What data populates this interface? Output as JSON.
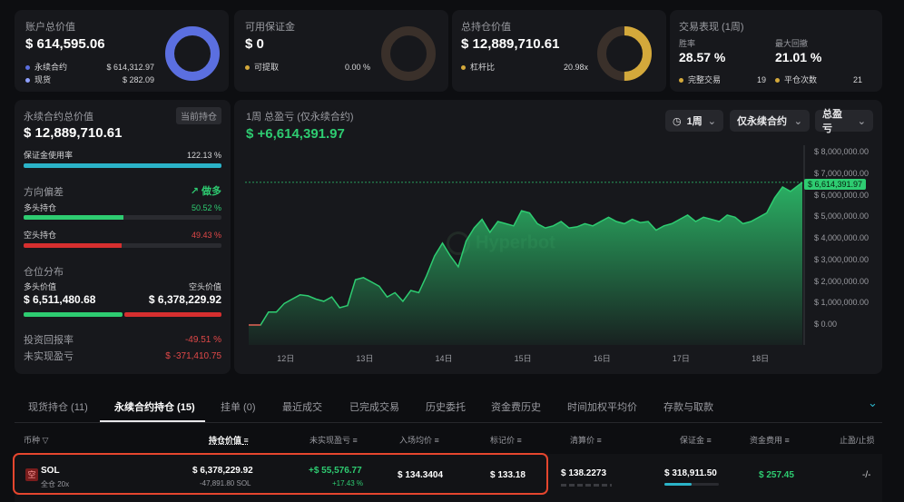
{
  "cards": {
    "account": {
      "title": "账户总价值",
      "value": "$ 614,595.06",
      "rows": [
        {
          "label": "永续合约",
          "value": "$ 614,312.97",
          "color": "#5b6fe0"
        },
        {
          "label": "现货",
          "value": "$ 282.09",
          "color": "#8fa0ff"
        }
      ],
      "ring_fill": 1.0,
      "ring_color": "#5b6fe0"
    },
    "margin": {
      "title": "可用保证金",
      "value": "$ 0",
      "rows": [
        {
          "label": "可提取",
          "value": "0.00 %",
          "color": "#d4a93b"
        }
      ],
      "ring_fill": 0.0,
      "ring_color": "#3a302a"
    },
    "position": {
      "title": "总持仓价值",
      "value": "$ 12,889,710.61",
      "rows": [
        {
          "label": "杠杆比",
          "value": "20.98x",
          "color": "#d4a93b"
        }
      ],
      "ring_fill": 0.5,
      "ring_color": "#d4a93b"
    },
    "performance": {
      "title": "交易表现 (1周)",
      "win_label": "胜率",
      "win_value": "28.57 %",
      "dd_label": "最大回撤",
      "dd_value": "21.01 %",
      "done_label": "完整交易",
      "done_value": "19",
      "close_label": "平仓次数",
      "close_value": "21",
      "dot_color": "#d4a93b"
    }
  },
  "perp": {
    "title": "永续合约总价值",
    "tag": "当前持仓",
    "value": "$ 12,889,710.61",
    "margin_label": "保证金使用率",
    "margin_value": "122.13 %",
    "margin_fill": 1.0,
    "bias_title": "方向偏差",
    "bias_value": "做多",
    "long_label": "多头持仓",
    "long_value": "50.52 %",
    "long_fill": 0.5052,
    "short_label": "空头持仓",
    "short_value": "49.43 %",
    "short_fill": 0.4943,
    "dist_title": "仓位分布",
    "long_val_label": "多头价值",
    "long_val": "$ 6,511,480.68",
    "short_val_label": "空头价值",
    "short_val": "$ 6,378,229.92",
    "roi_label": "投资回报率",
    "roi_value": "-49.51 %",
    "upnl_label": "未实现盈亏",
    "upnl_value": "$ -371,410.75"
  },
  "chart_panel": {
    "title": "1周 总盈亏 (仅永续合约)",
    "value": "$ +6,614,391.97",
    "dd_period": "1周",
    "dd_scope": "仅永续合约",
    "dd_metric": "总盈亏",
    "watermark": "Hyperbot"
  },
  "chart_data": {
    "type": "area",
    "ylim": [
      0,
      8000000
    ],
    "xlim": [
      11.55,
      18.55
    ],
    "yticks": [
      "$ 0.00",
      "$ 1,000,000.00",
      "$ 2,000,000.00",
      "$ 3,000,000.00",
      "$ 4,000,000.00",
      "$ 5,000,000.00",
      "$ 6,000,000.00",
      "$ 7,000,000.00",
      "$ 8,000,000.00"
    ],
    "xticks": [
      {
        "label": "12日",
        "x": 12
      },
      {
        "label": "13日",
        "x": 13
      },
      {
        "label": "14日",
        "x": 14
      },
      {
        "label": "15日",
        "x": 15
      },
      {
        "label": "16日",
        "x": 16
      },
      {
        "label": "17日",
        "x": 17
      },
      {
        "label": "18日",
        "x": 18
      }
    ],
    "last_label": "$ 6,614,391.97",
    "last_value": 6614391.97,
    "color": "#2ecc71",
    "x": [
      11.55,
      11.7,
      11.8,
      11.9,
      12.0,
      12.1,
      12.2,
      12.3,
      12.4,
      12.5,
      12.6,
      12.7,
      12.8,
      12.9,
      13.0,
      13.1,
      13.2,
      13.3,
      13.4,
      13.5,
      13.6,
      13.7,
      13.8,
      13.9,
      14.0,
      14.1,
      14.2,
      14.3,
      14.4,
      14.5,
      14.6,
      14.7,
      14.8,
      14.9,
      15.0,
      15.1,
      15.2,
      15.3,
      15.4,
      15.5,
      15.6,
      15.7,
      15.8,
      15.9,
      16.0,
      16.1,
      16.2,
      16.3,
      16.4,
      16.5,
      16.6,
      16.7,
      16.8,
      16.9,
      17.0,
      17.1,
      17.2,
      17.3,
      17.4,
      17.5,
      17.6,
      17.7,
      17.8,
      17.9,
      18.0,
      18.1,
      18.2,
      18.3,
      18.4,
      18.55
    ],
    "y": [
      0,
      0,
      600000,
      600000,
      1000000,
      1200000,
      1400000,
      1350000,
      1200000,
      1100000,
      1300000,
      800000,
      900000,
      2100000,
      2200000,
      2000000,
      1800000,
      1300000,
      1500000,
      1100000,
      1600000,
      1500000,
      2300000,
      3200000,
      3800000,
      3200000,
      2700000,
      3900000,
      4500000,
      4900000,
      4300000,
      4800000,
      4700000,
      4600000,
      5300000,
      5200000,
      4700000,
      4500000,
      4600000,
      4800000,
      4500000,
      4550000,
      4700000,
      4600000,
      4800000,
      5000000,
      4800000,
      4700000,
      4900000,
      4750000,
      4800000,
      4400000,
      4600000,
      4700000,
      4900000,
      5100000,
      4800000,
      5000000,
      4900000,
      4800000,
      5100000,
      5000000,
      4700000,
      4800000,
      5000000,
      5200000,
      5900000,
      6400000,
      6200000,
      6614391.97
    ]
  },
  "tabs": [
    "现货持仓 (11)",
    "永续合约持仓 (15)",
    "挂单 (0)",
    "最近成交",
    "已完成交易",
    "历史委托",
    "资金费历史",
    "时间加权平均价",
    "存款与取款"
  ],
  "table": {
    "headers": [
      "币种",
      "持仓价值",
      "未实现盈亏",
      "入场均价",
      "标记价",
      "清算价",
      "保证金",
      "资金费用",
      "止盈/止损"
    ],
    "row": {
      "side": "空",
      "coin": "SOL",
      "mode": "全仓 20x",
      "value": "$ 6,378,229.92",
      "size": "-47,891.80 SOL",
      "upnl": "+$ 55,576.77",
      "upnl_pct": "+17.43 %",
      "entry": "$ 134.3404",
      "mark": "$ 133.18",
      "liq": "$ 138.2273",
      "margin": "$ 318,911.50",
      "funding": "$ 257.45",
      "tpsl": "-/-"
    }
  }
}
